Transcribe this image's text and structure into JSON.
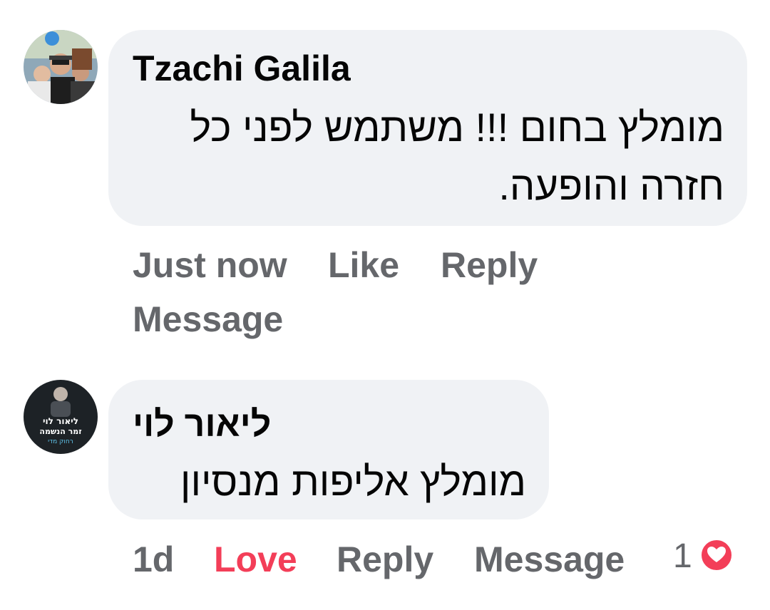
{
  "comments": [
    {
      "author": "Tzachi Galila",
      "text_line1": "מומלץ בחום !!! משתמש לפני כל",
      "text_line2": "חזרה והופעה.",
      "time": "Just now",
      "like_label": "Like",
      "reply_label": "Reply",
      "message_label": "Message"
    },
    {
      "author": "ליאור לוי",
      "avatar_caption_line1": "ליאור לוי",
      "avatar_caption_line2": "זמר הנשמה",
      "avatar_caption_line3": "רחוק מדי",
      "text": "מומלץ אליפות מנסיון",
      "time": "1d",
      "reaction_label": "Love",
      "reply_label": "Reply",
      "message_label": "Message",
      "reaction_count": "1",
      "reaction_icon": "heart-icon"
    }
  ],
  "colors": {
    "bubble": "#f0f2f5",
    "text": "#050505",
    "secondary": "#65676b",
    "love": "#f33e58"
  }
}
